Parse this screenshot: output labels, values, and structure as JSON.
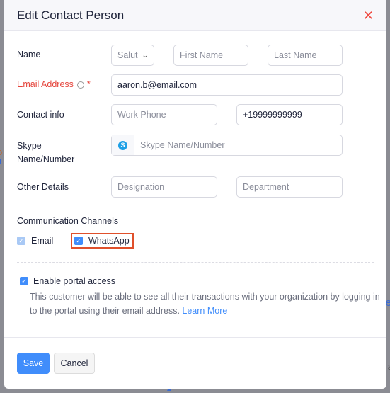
{
  "dialog": {
    "title": "Edit Contact Person",
    "close_icon": "close-icon"
  },
  "form": {
    "name": {
      "label": "Name",
      "salutation": {
        "value": "Salut",
        "icon": "chevron-down-icon"
      },
      "first_name": {
        "placeholder": "First Name",
        "value": ""
      },
      "last_name": {
        "placeholder": "Last Name",
        "value": ""
      }
    },
    "email": {
      "label": "Email Address",
      "info_icon": "ⓘ",
      "required_mark": "*",
      "value": "aaron.b@email.com"
    },
    "contact_info": {
      "label": "Contact info",
      "work_phone": {
        "placeholder": "Work Phone",
        "value": ""
      },
      "mobile": {
        "value": "+19999999999"
      }
    },
    "skype": {
      "label_line1": "Skype",
      "label_line2": "Name/Number",
      "icon": "skype-icon",
      "icon_glyph": "S",
      "placeholder": "Skype Name/Number"
    },
    "other_details": {
      "label": "Other Details",
      "designation": {
        "placeholder": "Designation"
      },
      "department": {
        "placeholder": "Department"
      }
    }
  },
  "communication_channels": {
    "title": "Communication Channels",
    "channels": [
      {
        "label": "Email",
        "checked": true,
        "disabled": true
      },
      {
        "label": "WhatsApp",
        "checked": true,
        "disabled": false,
        "highlighted": true
      }
    ]
  },
  "portal": {
    "label": "Enable portal access",
    "checked": true,
    "description": "This customer will be able to see all their transactions with your organization by logging in to the portal using their email address.",
    "learn_more": "Learn More"
  },
  "footer": {
    "save_label": "Save",
    "cancel_label": "Cancel"
  },
  "colors": {
    "accent": "#408dfb",
    "required": "#e5453c",
    "highlight_border": "#e0502b",
    "close": "#f0483e"
  },
  "check_glyph": "✓"
}
